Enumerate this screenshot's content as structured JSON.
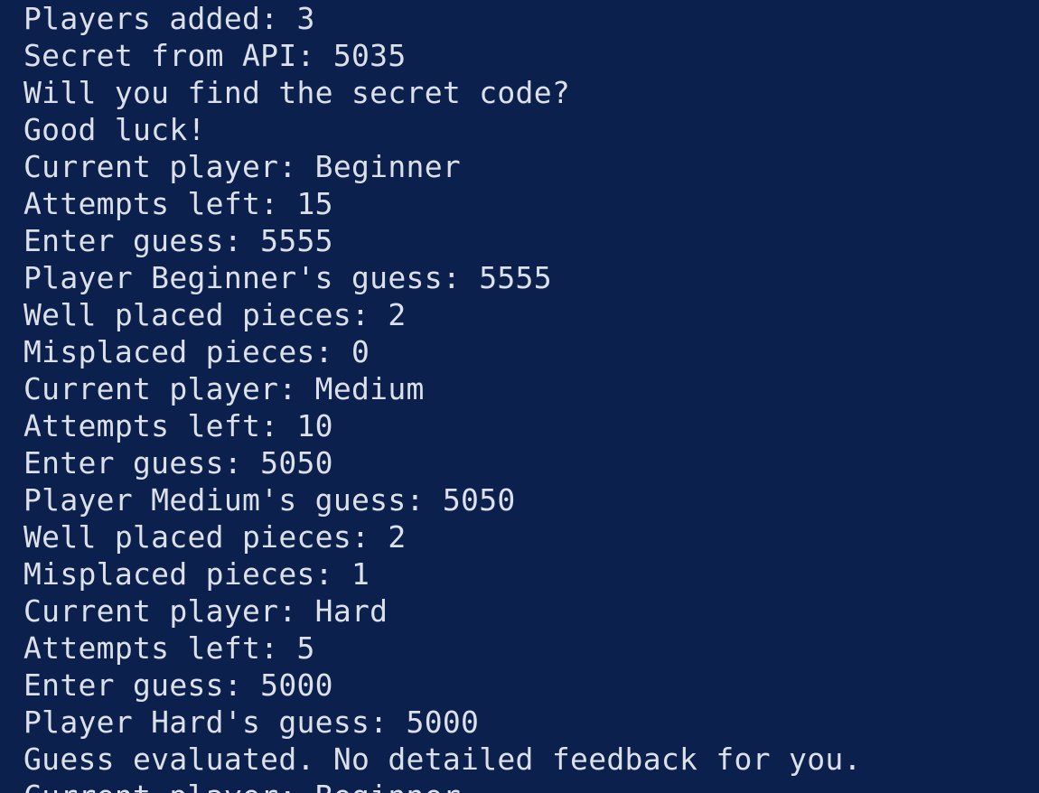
{
  "terminal": {
    "background": "#0b204d",
    "text_color": "#dce0e8",
    "lines": [
      "Players added: 3",
      "Secret from API: 5035",
      "Will you find the secret code?",
      "Good luck!",
      "Current player: Beginner",
      "Attempts left: 15",
      "Enter guess: 5555",
      "Player Beginner's guess: 5555",
      "Well placed pieces: 2",
      "Misplaced pieces: 0",
      "Current player: Medium",
      "Attempts left: 10",
      "Enter guess: 5050",
      "Player Medium's guess: 5050",
      "Well placed pieces: 2",
      "Misplaced pieces: 1",
      "Current player: Hard",
      "Attempts left: 5",
      "Enter guess: 5000",
      "Player Hard's guess: 5000",
      "Guess evaluated. No detailed feedback for you.",
      "Current player: Beginner"
    ]
  }
}
